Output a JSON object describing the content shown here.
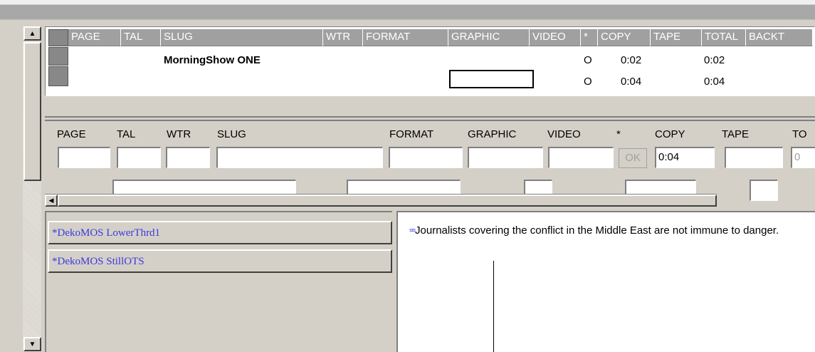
{
  "grid": {
    "columns": [
      "PAGE",
      "TAL",
      "SLUG",
      "WTR",
      "FORMAT",
      "GRAPHIC",
      "VIDEO",
      "*",
      "COPY",
      "TAPE",
      "TOTAL",
      "BACKT"
    ],
    "rows": [
      {
        "slug": "MorningShow ONE",
        "star": "O",
        "copy": "0:02",
        "total": "0:02"
      },
      {
        "slug": "",
        "star": "O",
        "copy": "0:04",
        "total": "0:04"
      }
    ]
  },
  "form": {
    "labels": {
      "page": "PAGE",
      "tal": "TAL",
      "wtr": "WTR",
      "slug": "SLUG",
      "format": "FORMAT",
      "graphic": "GRAPHIC",
      "video": "VIDEO",
      "star": "*",
      "copy": "COPY",
      "tape": "TAPE",
      "total": "TO"
    },
    "values": {
      "copy": "0:04",
      "total": "0"
    },
    "ok_label": "OK"
  },
  "production_cues": [
    {
      "label": "*DekoMOS LowerThrd1"
    },
    {
      "label": "*DekoMOS StillOTS"
    }
  ],
  "script": {
    "marker": "¤¤",
    "text": "Journalists covering the conflict in the Middle East are not immune to danger."
  },
  "icons": {
    "scroll_up": "triangle-up-icon",
    "scroll_down": "triangle-down-icon",
    "scroll_left": "triangle-left-icon"
  },
  "colors": {
    "header_bg": "#a0a0a0",
    "cue_text": "#3a3adc",
    "face": "#d4d0c8"
  }
}
